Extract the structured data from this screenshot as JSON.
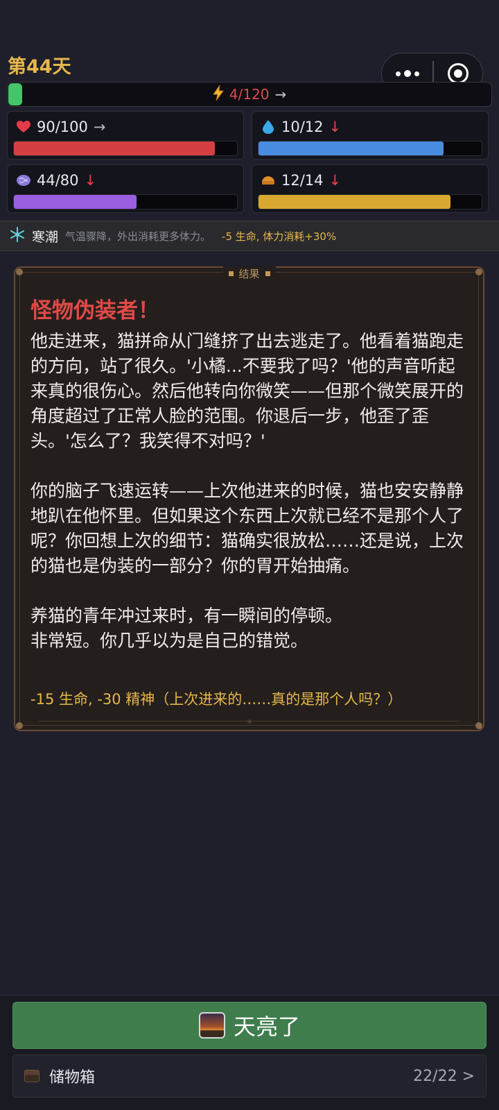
{
  "header": {
    "day_label": "第44天"
  },
  "energy": {
    "value": "4/120",
    "trend": "→",
    "fill_fraction": 0.02,
    "color": "#46c46a",
    "icon": "lightning-icon"
  },
  "stats": [
    {
      "icon": "heart-icon",
      "value": "90/100",
      "trend": "→",
      "fill_fraction": 0.9,
      "color": "#d44042"
    },
    {
      "icon": "water-drop-icon",
      "value": "10/12",
      "trend": "↓",
      "fill_fraction": 0.83,
      "color": "#4a8ce0"
    },
    {
      "icon": "brain-icon",
      "value": "44/80",
      "trend": "↓",
      "fill_fraction": 0.55,
      "color": "#9a5ee0"
    },
    {
      "icon": "food-icon",
      "value": "12/14",
      "trend": "↓",
      "fill_fraction": 0.86,
      "color": "#d8a830"
    }
  ],
  "weather": {
    "icon": "snowflake-icon",
    "name": "寒潮",
    "description": "气温骤降，外出消耗更多体力。",
    "effect": "-5 生命, 体力消耗+30%"
  },
  "result_panel": {
    "tag": "结果",
    "title": "怪物伪装者！",
    "body": "他走进来，猫拼命从门缝挤了出去逃走了。他看着猫跑走的方向，站了很久。'小橘...不要我了吗？'他的声音听起来真的很伤心。然后他转向你微笑——但那个微笑展开的角度超过了正常人脸的范围。你退后一步，他歪了歪头。'怎么了？我笑得不对吗？'\n\n你的脑子飞速运转——上次他进来的时候，猫也安安静静地趴在他怀里。但如果这个东西上次就已经不是那个人了呢？你回想上次的细节：猫确实很放松……还是说，上次的猫也是伪装的一部分？你的胃开始抽痛。\n\n养猫的青年冲过来时，有一瞬间的停顿。\n非常短。你几乎以为是自己的错觉。",
    "result": "-15 生命, -30 精神（上次进来的……真的是那个人吗？）"
  },
  "actions": {
    "main_button_label": "天亮了",
    "main_button_icon": "sunrise-icon",
    "storage_label": "储物箱",
    "storage_count": "22/22 >",
    "storage_icon": "chest-icon"
  }
}
